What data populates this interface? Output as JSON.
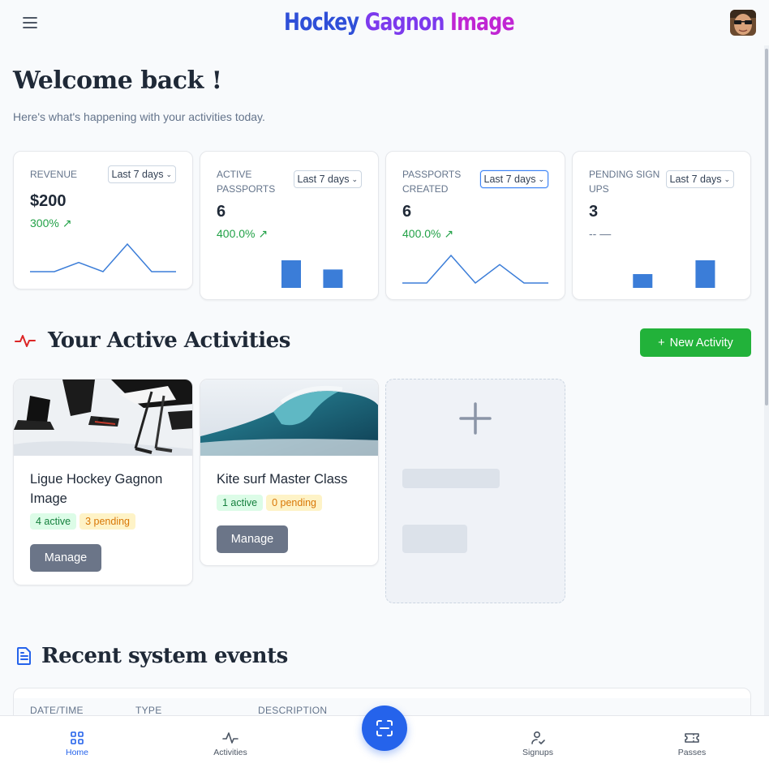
{
  "header": {
    "brand_part1": "Hockey",
    "brand_part2": "Gagnon",
    "brand_part3": "Image"
  },
  "welcome": {
    "title": "Welcome back !",
    "subtitle": "Here's what's happening with your activities today."
  },
  "stats": [
    {
      "label": "REVENUE",
      "period": "Last 7 days",
      "value": "$200",
      "change": "300%",
      "trend": "up",
      "chart": "line",
      "series": [
        0,
        0,
        1,
        0,
        3,
        0,
        0
      ]
    },
    {
      "label": "ACTIVE PASSPORTS",
      "period": "Last 7 days",
      "value": "6",
      "change": "400.0%",
      "trend": "up",
      "chart": "bar",
      "series": [
        0,
        0,
        0,
        3,
        0,
        2,
        0
      ]
    },
    {
      "label": "PASSPORTS CREATED",
      "period": "Last 7 days",
      "value": "6",
      "change": "400.0%",
      "trend": "up",
      "chart": "line",
      "series": [
        0,
        0,
        3,
        0,
        2,
        0,
        0
      ]
    },
    {
      "label": "PENDING SIGN UPS",
      "period": "Last 7 days",
      "value": "3",
      "change": "--",
      "trend": "flat",
      "chart": "bar",
      "series": [
        0,
        0,
        1,
        0,
        0,
        2,
        0
      ]
    }
  ],
  "activities_section": {
    "title": "Your Active Activities",
    "new_button": "New Activity"
  },
  "activities": [
    {
      "title": "Ligue Hockey Gagnon Image",
      "active": "4 active",
      "pending": "3 pending",
      "manage": "Manage"
    },
    {
      "title": "Kite surf Master Class",
      "active": "1 active",
      "pending": "0 pending",
      "manage": "Manage"
    }
  ],
  "events_section": {
    "title": "Recent system events",
    "columns": [
      "DATE/TIME",
      "TYPE",
      "DESCRIPTION"
    ]
  },
  "bottom_nav": {
    "home": "Home",
    "activities": "Activities",
    "signups": "Signups",
    "passes": "Passes"
  },
  "colors": {
    "primary": "#2563eb",
    "success": "#22b23a",
    "chart": "#3b7dd8"
  }
}
